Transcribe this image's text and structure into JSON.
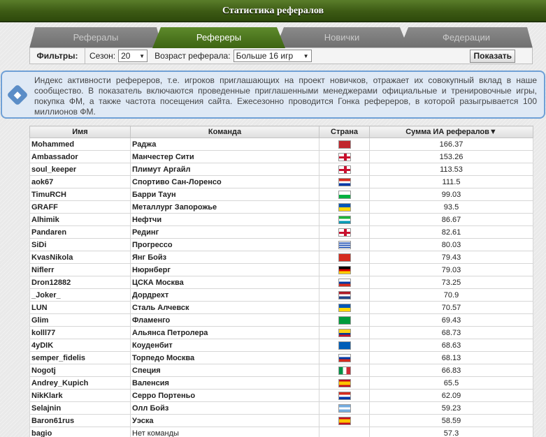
{
  "title": "Статистика рефералов",
  "tabs": [
    {
      "label": "Рефералы",
      "active": false
    },
    {
      "label": "Рефереры",
      "active": true
    },
    {
      "label": "Новички",
      "active": false
    },
    {
      "label": "Федерации",
      "active": false
    }
  ],
  "filters": {
    "label": "Фильтры:",
    "season_label": "Сезон:",
    "season_value": "20",
    "age_label": "Возраст реферала:",
    "age_value": "Больше 16 игр",
    "show_button": "Показать"
  },
  "info": {
    "icon": "◆",
    "text": "Индекс активности рефереров, т.е. игроков приглашающих на проект новичков, отражает их совокупный вклад в наше сообщество. В показатель включаются проведенные приглашенными менеджерами официальные и тренировочные игры, покупка ФМ, а также частота посещения сайта. Ежесезонно проводится Гонка рефереров, в которой разыгрывается 100 миллионов ФМ."
  },
  "table": {
    "headers": {
      "name": "Имя",
      "team": "Команда",
      "country": "Страна",
      "sum": "Сумма ИА рефералов▼"
    },
    "rows": [
      {
        "name": "Mohammed",
        "team": "Раджа",
        "flag": "morocco",
        "value": "166.37"
      },
      {
        "name": "Ambassador",
        "team": "Манчестер Сити",
        "flag": "england",
        "value": "153.26"
      },
      {
        "name": "soul_keeper",
        "team": "Плимут Аргайл",
        "flag": "england",
        "value": "113.53"
      },
      {
        "name": "aok67",
        "team": "Спортиво Сан-Лоренсо",
        "flag": "paraguay",
        "value": "111.5"
      },
      {
        "name": "TimuRCH",
        "team": "Барри Таун",
        "flag": "wales",
        "value": "99.03"
      },
      {
        "name": "GRAFF",
        "team": "Металлург Запорожье",
        "flag": "ukraine",
        "value": "93.5"
      },
      {
        "name": "Alhimik",
        "team": "Нефтчи",
        "flag": "uzbekistan",
        "value": "86.67"
      },
      {
        "name": "Pandaren",
        "team": "Рединг",
        "flag": "england",
        "value": "82.61"
      },
      {
        "name": "SiDi",
        "team": "Прогрессо",
        "flag": "uruguay",
        "value": "80.03"
      },
      {
        "name": "KvasNikola",
        "team": "Янг Бойз",
        "flag": "switzerland",
        "value": "79.43"
      },
      {
        "name": "Niflerr",
        "team": "Нюрнберг",
        "flag": "germany",
        "value": "79.03"
      },
      {
        "name": "Dron12882",
        "team": "ЦСКА Москва",
        "flag": "russia",
        "value": "73.25"
      },
      {
        "name": "_Joker_",
        "team": "Дордрехт",
        "flag": "netherlands",
        "value": "70.9"
      },
      {
        "name": "LUN",
        "team": "Сталь Алчевск",
        "flag": "ukraine",
        "value": "70.57"
      },
      {
        "name": "Glim",
        "team": "Фламенго",
        "flag": "brazil",
        "value": "69.43"
      },
      {
        "name": "kolll77",
        "team": "Альянса Петролера",
        "flag": "colombia",
        "value": "68.73"
      },
      {
        "name": "4yDIK",
        "team": "Коуденбит",
        "flag": "scotland",
        "value": "68.63"
      },
      {
        "name": "semper_fidelis",
        "team": "Торпедо Москва",
        "flag": "russia",
        "value": "68.13"
      },
      {
        "name": "Nogotj",
        "team": "Специя",
        "flag": "italy",
        "value": "66.83"
      },
      {
        "name": "Andrey_Kupich",
        "team": "Валенсия",
        "flag": "spain",
        "value": "65.5"
      },
      {
        "name": "NikKlark",
        "team": "Серро Портеньо",
        "flag": "paraguay",
        "value": "62.09"
      },
      {
        "name": "Selajnin",
        "team": "Олл Бойз",
        "flag": "argentina",
        "value": "59.23"
      },
      {
        "name": "Baron61rus",
        "team": "Уэска",
        "flag": "spain",
        "value": "58.59"
      },
      {
        "name": "bagio",
        "team": "Нет команды",
        "flag": "",
        "value": "57.3",
        "no_team": true
      }
    ]
  },
  "colors": {
    "header_green": "#3c5a14",
    "tab_active": "#4d7a1e",
    "info_border": "#6fa0d6"
  }
}
